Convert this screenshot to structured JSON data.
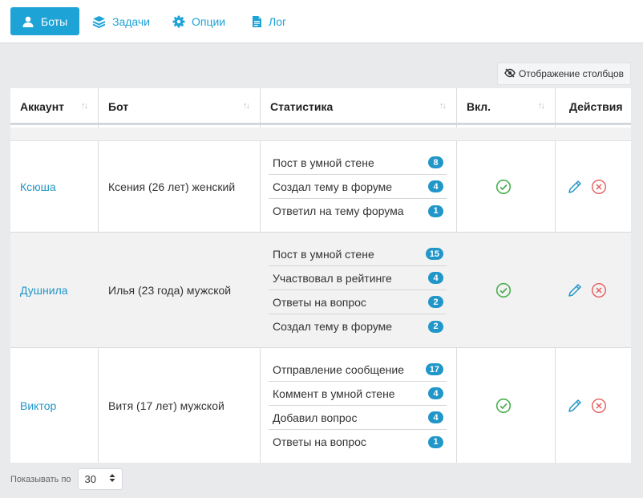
{
  "nav": {
    "tabs": [
      {
        "label": "Боты",
        "icon": "user-icon",
        "active": true
      },
      {
        "label": "Задачи",
        "icon": "layers-icon",
        "active": false
      },
      {
        "label": "Опции",
        "icon": "gear-icon",
        "active": false
      },
      {
        "label": "Лог",
        "icon": "file-icon",
        "active": false
      }
    ]
  },
  "toolbar": {
    "columns_button_label": "Отображение столбцов",
    "columns_icon": "eye-slash-icon"
  },
  "table": {
    "headers": {
      "account": "Аккаунт",
      "bot": "Бот",
      "stats": "Статистика",
      "enabled": "Вкл.",
      "actions": "Действия"
    },
    "rows": [
      {
        "account": "Ксюша",
        "bot": "Ксения (26 лет) женский",
        "enabled": true,
        "stats": [
          {
            "label": "Пост в умной стене",
            "count": "8"
          },
          {
            "label": "Создал тему в форуме",
            "count": "4"
          },
          {
            "label": "Ответил на тему форума",
            "count": "1"
          }
        ]
      },
      {
        "account": "Душнила",
        "bot": "Илья (23 года) мужской",
        "enabled": true,
        "stats": [
          {
            "label": "Пост в умной стене",
            "count": "15"
          },
          {
            "label": "Участвовал в рейтинге",
            "count": "4"
          },
          {
            "label": "Ответы на вопрос",
            "count": "2"
          },
          {
            "label": "Создал тему в форуме",
            "count": "2"
          }
        ]
      },
      {
        "account": "Виктор",
        "bot": "Витя (17 лет) мужской",
        "enabled": true,
        "stats": [
          {
            "label": "Отправление сообщение",
            "count": "17"
          },
          {
            "label": "Коммент в умной стене",
            "count": "4"
          },
          {
            "label": "Добавил вопрос",
            "count": "4"
          },
          {
            "label": "Ответы на вопрос",
            "count": "1"
          }
        ]
      }
    ]
  },
  "footer": {
    "per_page_label": "Показывать по",
    "per_page_value": "30"
  },
  "colors": {
    "accent": "#1ea3d6",
    "link": "#2196c9",
    "enabled": "#4caf50",
    "delete": "#e65c5c"
  }
}
